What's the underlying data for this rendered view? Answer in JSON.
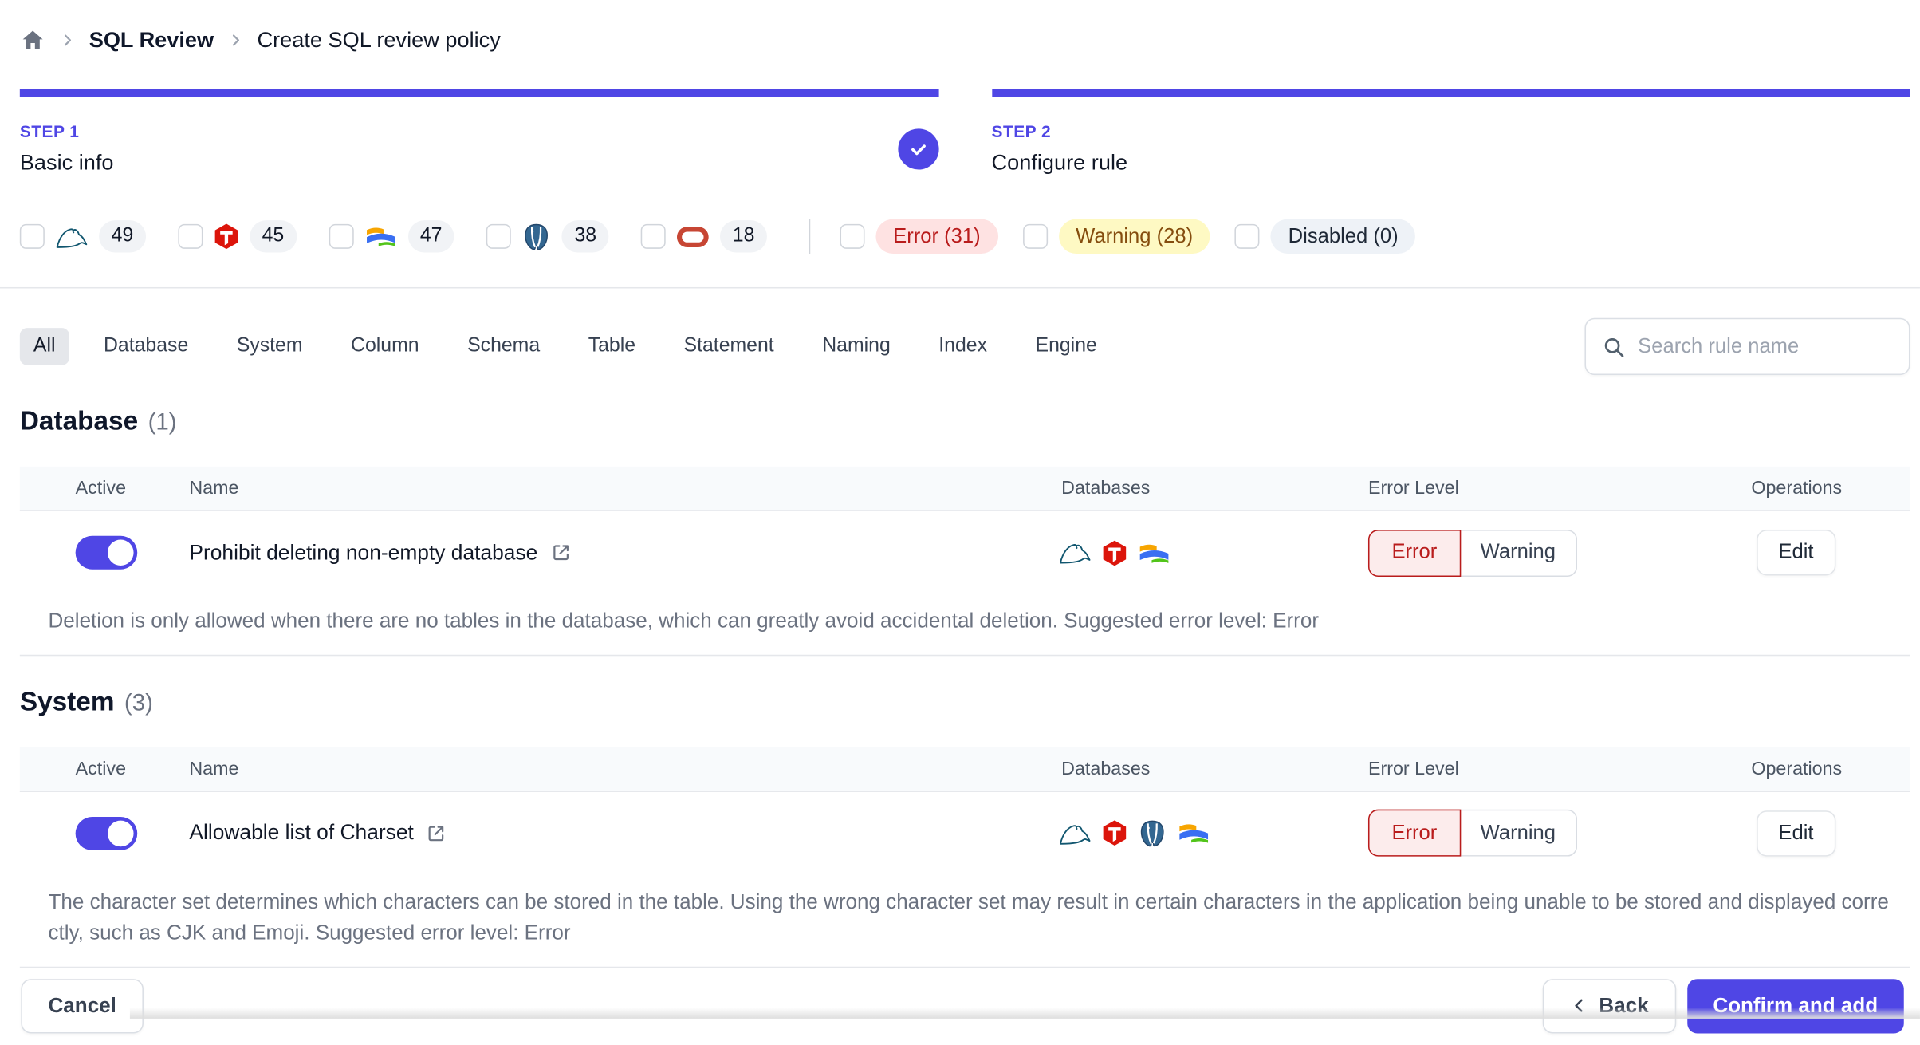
{
  "breadcrumb": {
    "items": [
      "SQL Review",
      "Create SQL review policy"
    ]
  },
  "steps": [
    {
      "label": "STEP 1",
      "title": "Basic info",
      "completed": true
    },
    {
      "label": "STEP 2",
      "title": "Configure rule",
      "completed": false
    }
  ],
  "filters": {
    "engines": [
      {
        "engine": "mysql",
        "count": "49"
      },
      {
        "engine": "tidb",
        "count": "45"
      },
      {
        "engine": "oceanbase",
        "count": "47"
      },
      {
        "engine": "postgres",
        "count": "38"
      },
      {
        "engine": "oracle",
        "count": "18"
      }
    ],
    "levels": [
      {
        "label": "Error (31)",
        "type": "error"
      },
      {
        "label": "Warning (28)",
        "type": "warning"
      },
      {
        "label": "Disabled (0)",
        "type": "disabled"
      }
    ]
  },
  "tabs": {
    "items": [
      "All",
      "Database",
      "System",
      "Column",
      "Schema",
      "Table",
      "Statement",
      "Naming",
      "Index",
      "Engine"
    ],
    "selected": "All"
  },
  "search": {
    "placeholder": "Search rule name"
  },
  "table": {
    "columns": [
      "Active",
      "Name",
      "Databases",
      "Error Level",
      "Operations"
    ],
    "level_options": [
      "Error",
      "Warning"
    ],
    "edit_label": "Edit"
  },
  "sections": [
    {
      "title": "Database",
      "count": "(1)",
      "rules": [
        {
          "name": "Prohibit deleting non-empty database",
          "active": true,
          "engines": [
            "mysql",
            "tidb",
            "oceanbase"
          ],
          "selected_level": "Error",
          "description": "Deletion is only allowed when there are no tables in the database, which can greatly avoid accidental deletion. Suggested error level: Error"
        }
      ]
    },
    {
      "title": "System",
      "count": "(3)",
      "rules": [
        {
          "name": "Allowable list of Charset",
          "active": true,
          "engines": [
            "mysql",
            "tidb",
            "postgres",
            "oceanbase"
          ],
          "selected_level": "Error",
          "description": "The character set determines which characters can be stored in the table. Using the wrong character set may result in certain characters in the application being unable to be stored and displayed correctly, such as CJK and Emoji. Suggested error level: Error"
        }
      ]
    }
  ],
  "footer": {
    "cancel": "Cancel",
    "back": "Back",
    "confirm": "Confirm and add"
  },
  "colors": {
    "accent": "#4f46e5",
    "error_text": "#b91c1c",
    "error_bg": "#fee2e2",
    "warning_text": "#854d0e",
    "warning_bg": "#fef9c3",
    "disabled_bg": "#eef2f7",
    "count_bg": "#f1f3f6"
  }
}
